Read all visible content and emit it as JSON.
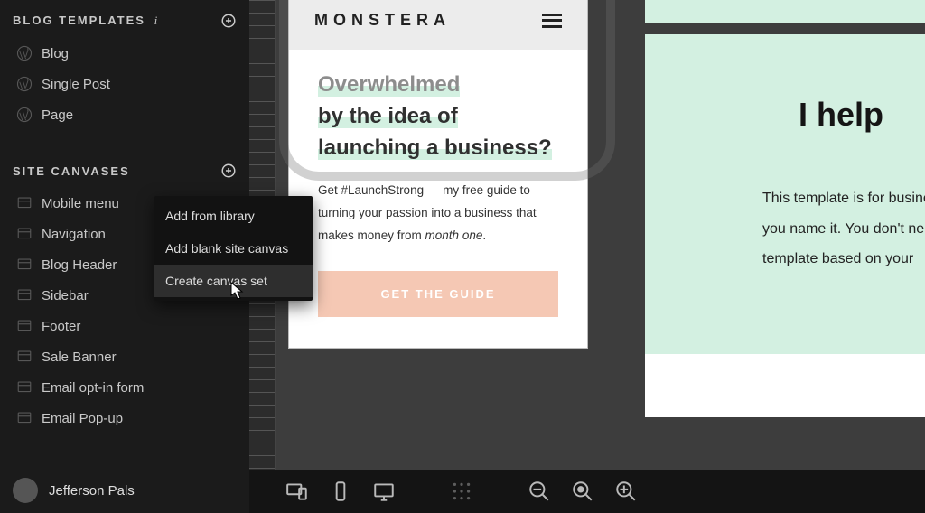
{
  "sidebar": {
    "blog_templates_header": "BLOG TEMPLATES",
    "blog_items": [
      {
        "label": "Blog"
      },
      {
        "label": "Single Post"
      },
      {
        "label": "Page"
      }
    ],
    "site_canvases_header": "SITE CANVASES",
    "canvas_items": [
      {
        "label": "Mobile menu"
      },
      {
        "label": "Navigation"
      },
      {
        "label": "Blog Header"
      },
      {
        "label": "Sidebar"
      },
      {
        "label": "Footer"
      },
      {
        "label": "Sale Banner"
      },
      {
        "label": "Email opt-in form"
      },
      {
        "label": "Email Pop-up"
      }
    ]
  },
  "context_menu": {
    "items": [
      {
        "label": "Add from library"
      },
      {
        "label": "Add blank site canvas"
      },
      {
        "label": "Create canvas set"
      }
    ],
    "hover_index": 2
  },
  "user": {
    "name": "Jefferson Pals"
  },
  "mobile_canvas": {
    "logo": "MONSTERA",
    "heading_line1": "Overwhelmed",
    "heading_rest": "by the idea of launching a business?",
    "paragraph_prefix": "Get #LaunchStrong — my free guide to turning your passion into a business that makes money from ",
    "paragraph_italic": "month one",
    "paragraph_suffix": ".",
    "cta": "GET THE GUIDE"
  },
  "pane2": {
    "heading": "I help",
    "body": "This template is for business owners and bloggers, you name it. You don't need to worry about choosing a template based on your"
  },
  "toolbar": {
    "icons": [
      "devices",
      "phone",
      "desktop",
      "grid",
      "zoom-out",
      "zoom-reset",
      "zoom-in"
    ]
  }
}
